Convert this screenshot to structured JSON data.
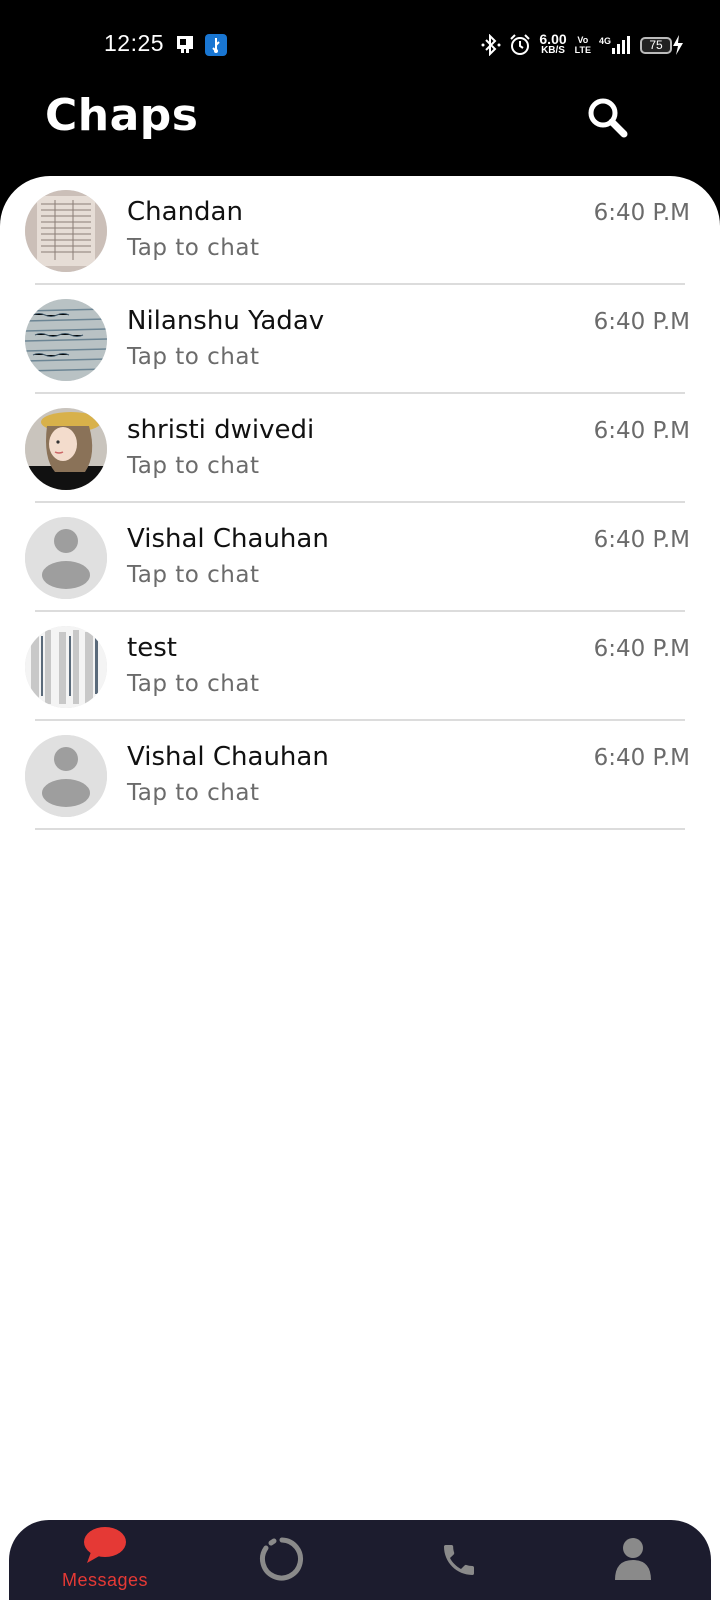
{
  "status_bar": {
    "time": "12:25",
    "net_speed_value": "6.00",
    "net_speed_unit": "KB/S",
    "volte_top": "Vo",
    "volte_bottom": "LTE",
    "network": "4G",
    "battery": "75"
  },
  "header": {
    "title": "Chaps",
    "search_icon": "search-icon"
  },
  "chats": [
    {
      "name": "Chandan",
      "subtitle": "Tap to chat",
      "time": "6:40 P.M",
      "avatar": "photo-document"
    },
    {
      "name": "Nilanshu Yadav",
      "subtitle": "Tap to chat",
      "time": "6:40 P.M",
      "avatar": "photo-notebook"
    },
    {
      "name": "shristi dwivedi",
      "subtitle": "Tap to chat",
      "time": "6:40 P.M",
      "avatar": "photo-illustration"
    },
    {
      "name": "Vishal Chauhan",
      "subtitle": "Tap to chat",
      "time": "6:40 P.M",
      "avatar": "default-person"
    },
    {
      "name": "test",
      "subtitle": "Tap to chat",
      "time": "6:40 P.M",
      "avatar": "photo-pages"
    },
    {
      "name": "Vishal Chauhan",
      "subtitle": "Tap to chat",
      "time": "6:40 P.M",
      "avatar": "default-person"
    }
  ],
  "bottom_nav": {
    "items": [
      {
        "label": "Messages",
        "icon": "chat-bubble-icon",
        "active": true
      },
      {
        "label": "",
        "icon": "status-icon",
        "active": false
      },
      {
        "label": "",
        "icon": "phone-icon",
        "active": false
      },
      {
        "label": "",
        "icon": "person-icon",
        "active": false
      }
    ]
  },
  "colors": {
    "accent": "#e53935",
    "nav_background": "#1c1c2e",
    "header_background": "#000000"
  }
}
